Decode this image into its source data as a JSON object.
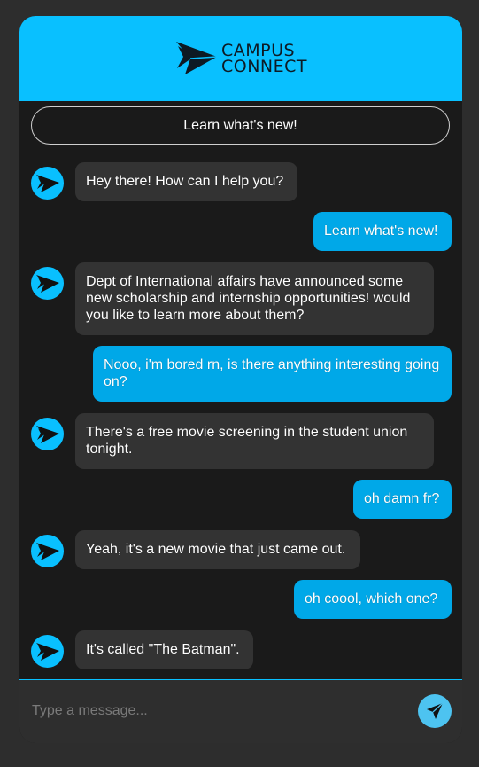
{
  "app": {
    "logo_line1": "CAMPUS",
    "logo_line2": "CONNECT",
    "icon": "paper-plane-logo"
  },
  "quick_reply": {
    "label": "Learn what's new!"
  },
  "messages": [
    {
      "from": "bot",
      "text": "Hey there! How can I help you?"
    },
    {
      "from": "user",
      "text": "Learn what's new!"
    },
    {
      "from": "bot",
      "text": "Dept of International affairs have announced some new scholarship and internship opportunities! would you like to learn more about them?"
    },
    {
      "from": "user",
      "text": "Nooo, i'm bored rn, is there anything interesting going on?"
    },
    {
      "from": "bot",
      "text": "There's a free movie screening in the student union tonight."
    },
    {
      "from": "user",
      "text": "oh damn fr?"
    },
    {
      "from": "bot",
      "text": "Yeah, it's a new movie that just came out."
    },
    {
      "from": "user",
      "text": "oh coool, which one?"
    },
    {
      "from": "bot",
      "text": "It's called \"The Batman\"."
    }
  ],
  "composer": {
    "placeholder": "Type a message...",
    "send_icon": "send-icon"
  },
  "colors": {
    "accent": "#09c0ff",
    "user_bubble": "#00a8e8",
    "bot_bubble": "#333333",
    "background": "#1a1a1a"
  }
}
